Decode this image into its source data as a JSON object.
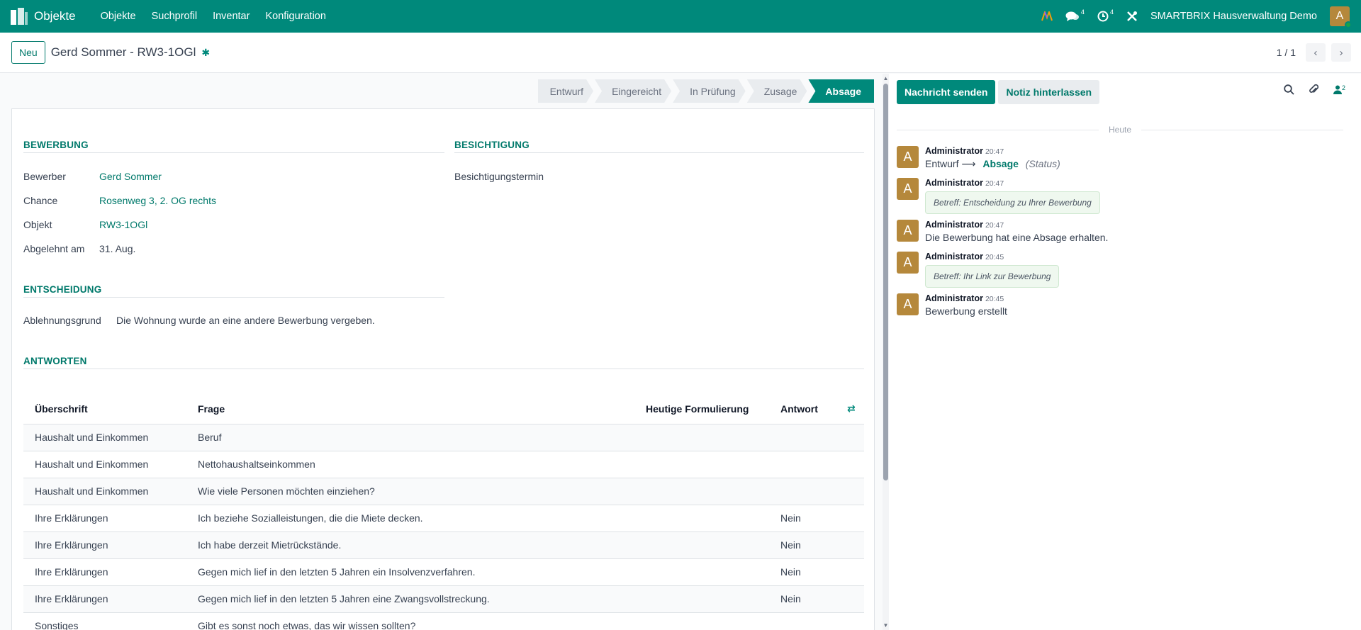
{
  "navbar": {
    "app_name": "Objekte",
    "menu": [
      "Objekte",
      "Suchprofil",
      "Inventar",
      "Konfiguration"
    ],
    "messages_count": "4",
    "activities_count": "4",
    "company": "SMARTBRIX Hausverwaltung Demo",
    "avatar_letter": "A"
  },
  "control": {
    "new_label": "Neu",
    "title": "Gerd Sommer - RW3-1OGl",
    "pager_value": "1 / 1"
  },
  "status_stages": [
    "Entwurf",
    "Eingereicht",
    "In Prüfung",
    "Zusage",
    "Absage"
  ],
  "status_active": "Absage",
  "bewerbung": {
    "title": "BEWERBUNG",
    "fields": [
      {
        "label": "Bewerber",
        "value": "Gerd Sommer"
      },
      {
        "label": "Chance",
        "value": "Rosenweg 3, 2. OG rechts"
      },
      {
        "label": "Objekt",
        "value": "RW3-1OGl"
      },
      {
        "label": "Abgelehnt am",
        "value": "31. Aug."
      }
    ]
  },
  "besichtigung": {
    "title": "BESICHTIGUNG",
    "label": "Besichtigungstermin"
  },
  "entscheidung": {
    "title": "ENTSCHEIDUNG",
    "label": "Ablehnungsgrund",
    "value": "Die Wohnung wurde an eine andere Bewerbung vergeben."
  },
  "antworten": {
    "title": "ANTWORTEN",
    "columns": [
      "Überschrift",
      "Frage",
      "Heutige Formulierung",
      "Antwort"
    ],
    "rows": [
      [
        "Haushalt und Einkommen",
        "Beruf",
        "",
        ""
      ],
      [
        "Haushalt und Einkommen",
        "Nettohaushaltseinkommen",
        "",
        ""
      ],
      [
        "Haushalt und Einkommen",
        "Wie viele Personen möchten einziehen?",
        "",
        ""
      ],
      [
        "Ihre Erklärungen",
        "Ich beziehe Sozialleistungen, die die Miete decken.",
        "",
        "Nein"
      ],
      [
        "Ihre Erklärungen",
        "Ich habe derzeit Mietrückstände.",
        "",
        "Nein"
      ],
      [
        "Ihre Erklärungen",
        "Gegen mich lief in den letzten 5 Jahren ein Insolvenzverfahren.",
        "",
        "Nein"
      ],
      [
        "Ihre Erklärungen",
        "Gegen mich lief in den letzten 5 Jahren eine Zwangsvollstreckung.",
        "",
        "Nein"
      ],
      [
        "Sonstiges",
        "Gibt es sonst noch etwas, das wir wissen sollten?",
        "",
        ""
      ]
    ]
  },
  "chatter": {
    "send_label": "Nachricht senden",
    "note_label": "Notiz hinterlassen",
    "followers_count": "2",
    "today_label": "Heute",
    "messages": [
      {
        "author": "Administrator",
        "time": "20:47",
        "type": "tracking",
        "from": "Entwurf",
        "arrow": "⟶",
        "to": "Absage",
        "field": "(Status)"
      },
      {
        "author": "Administrator",
        "time": "20:47",
        "type": "bubble",
        "text": "Betreff: Entscheidung zu Ihrer Bewerbung"
      },
      {
        "author": "Administrator",
        "time": "20:47",
        "type": "text",
        "text": "Die Bewerbung hat eine Absage erhalten."
      },
      {
        "author": "Administrator",
        "time": "20:45",
        "type": "bubble",
        "text": "Betreff: Ihr Link zur Bewerbung"
      },
      {
        "author": "Administrator",
        "time": "20:45",
        "type": "text",
        "text": "Bewerbung erstellt"
      }
    ]
  },
  "colors": {
    "brand": "#00897b",
    "link": "#00796b",
    "avatar": "#b5883b"
  }
}
